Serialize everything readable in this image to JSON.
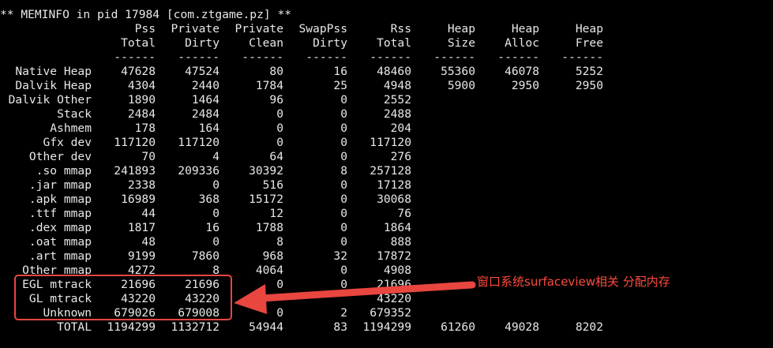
{
  "title": "** MEMINFO in pid 17984 [com.ztgame.pz] **",
  "header": {
    "row1": [
      "",
      "Pss",
      "Private",
      "Private",
      "SwapPss",
      "Rss",
      "Heap",
      "Heap",
      "Heap"
    ],
    "row2": [
      "",
      "Total",
      "Dirty",
      "Clean",
      "Dirty",
      "Total",
      "Size",
      "Alloc",
      "Free"
    ],
    "sep": [
      "",
      "------",
      "------",
      "------",
      "------",
      "------",
      "------",
      "------",
      "------"
    ]
  },
  "rows": [
    [
      "Native Heap",
      "47628",
      "47524",
      "80",
      "16",
      "48460",
      "55360",
      "46078",
      "5252"
    ],
    [
      "Dalvik Heap",
      "4304",
      "2440",
      "1784",
      "25",
      "4948",
      "5900",
      "2950",
      "2950"
    ],
    [
      "Dalvik Other",
      "1890",
      "1464",
      "96",
      "0",
      "2552",
      "",
      "",
      ""
    ],
    [
      "Stack",
      "2484",
      "2484",
      "0",
      "0",
      "2488",
      "",
      "",
      ""
    ],
    [
      "Ashmem",
      "178",
      "164",
      "0",
      "0",
      "204",
      "",
      "",
      ""
    ],
    [
      "Gfx dev",
      "117120",
      "117120",
      "0",
      "0",
      "117120",
      "",
      "",
      ""
    ],
    [
      "Other dev",
      "70",
      "4",
      "64",
      "0",
      "276",
      "",
      "",
      ""
    ],
    [
      ".so mmap",
      "241893",
      "209336",
      "30392",
      "8",
      "257128",
      "",
      "",
      ""
    ],
    [
      ".jar mmap",
      "2338",
      "0",
      "516",
      "0",
      "17128",
      "",
      "",
      ""
    ],
    [
      ".apk mmap",
      "16989",
      "368",
      "15172",
      "0",
      "30068",
      "",
      "",
      ""
    ],
    [
      ".ttf mmap",
      "44",
      "0",
      "12",
      "0",
      "76",
      "",
      "",
      ""
    ],
    [
      ".dex mmap",
      "1817",
      "16",
      "1788",
      "0",
      "1864",
      "",
      "",
      ""
    ],
    [
      ".oat mmap",
      "48",
      "0",
      "8",
      "0",
      "888",
      "",
      "",
      ""
    ],
    [
      ".art mmap",
      "9199",
      "7860",
      "968",
      "32",
      "17872",
      "",
      "",
      ""
    ],
    [
      "Other mmap",
      "4272",
      "8",
      "4064",
      "0",
      "4908",
      "",
      "",
      ""
    ],
    [
      "EGL mtrack",
      "21696",
      "21696",
      "0",
      "0",
      "21696",
      "",
      "",
      ""
    ],
    [
      "GL mtrack",
      "43220",
      "43220",
      "",
      "",
      "43220",
      "",
      "",
      ""
    ],
    [
      "Unknown",
      "679026",
      "679008",
      "0",
      "2",
      "679352",
      "",
      "",
      ""
    ],
    [
      "TOTAL",
      "1194299",
      "1132712",
      "54944",
      "83",
      "1194299",
      "61260",
      "49028",
      "8202"
    ]
  ],
  "annotation": {
    "label": "窗口系统surfaceview相关 分配内存",
    "color": "#e8463f"
  }
}
